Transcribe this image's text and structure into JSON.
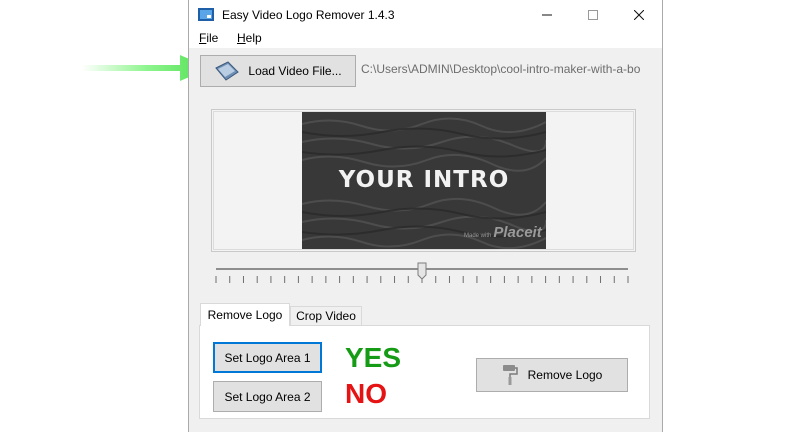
{
  "window": {
    "title": "Easy Video Logo Remover 1.4.3",
    "controls": {
      "minimize": "—",
      "maximize": "☐",
      "close": "✕"
    }
  },
  "menu": [
    {
      "mnemonic": "F",
      "rest": "ile"
    },
    {
      "mnemonic": "H",
      "rest": "elp"
    }
  ],
  "toolbar": {
    "load_label": "Load Video File...",
    "file_path": "C:\\Users\\ADMIN\\Desktop\\cool-intro-maker-with-a-bo"
  },
  "preview": {
    "video_text": "YOUR INTRO",
    "watermark_small": "Made with",
    "watermark": "Placeit"
  },
  "slider": {
    "position_fraction": 0.5
  },
  "tabs": [
    {
      "label": "Remove Logo",
      "active": true
    },
    {
      "label": "Crop Video",
      "active": false
    }
  ],
  "remove_logo_tab": {
    "area1_label": "Set Logo Area 1",
    "area2_label": "Set Logo Area 2",
    "remove_label": "Remove Logo"
  },
  "annotations": {
    "yes": "YES",
    "no": "NO"
  },
  "colors": {
    "arrow": "#7cf27c",
    "yes": "#169b17",
    "no": "#e51313",
    "focus": "#0078d7"
  }
}
